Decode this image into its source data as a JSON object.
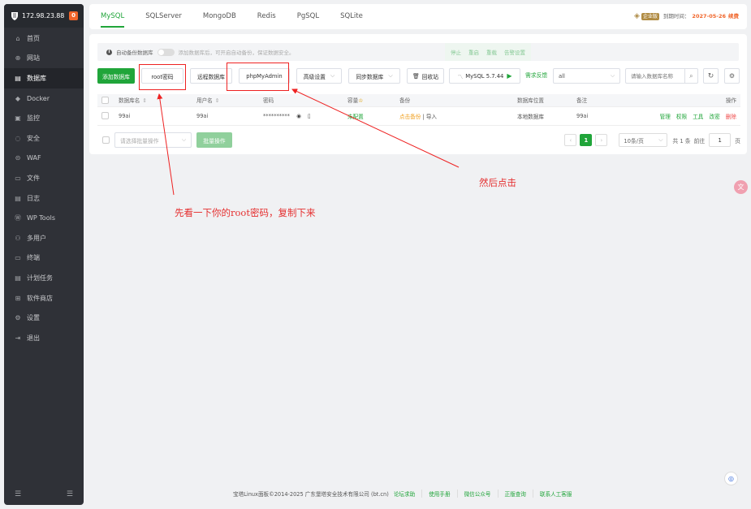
{
  "sidebar": {
    "ip": "172.98.23.88",
    "badge": "0",
    "items": [
      {
        "label": "首页",
        "icon": "home-icon",
        "glyph": "⌂"
      },
      {
        "label": "网站",
        "icon": "globe-icon",
        "glyph": "⊕"
      },
      {
        "label": "数据库",
        "icon": "database-icon",
        "glyph": "▤",
        "active": true
      },
      {
        "label": "Docker",
        "icon": "docker-icon",
        "glyph": "◆"
      },
      {
        "label": "监控",
        "icon": "monitor-icon",
        "glyph": "▣"
      },
      {
        "label": "安全",
        "icon": "shield-icon",
        "glyph": "◌"
      },
      {
        "label": "WAF",
        "icon": "waf-icon",
        "glyph": "⊝"
      },
      {
        "label": "文件",
        "icon": "folder-icon",
        "glyph": "▭"
      },
      {
        "label": "日志",
        "icon": "log-icon",
        "glyph": "▤"
      },
      {
        "label": "WP Tools",
        "icon": "wordpress-icon",
        "glyph": "Ⓦ"
      },
      {
        "label": "多用户",
        "icon": "users-icon",
        "glyph": "⚇"
      },
      {
        "label": "终端",
        "icon": "terminal-icon",
        "glyph": "▭"
      },
      {
        "label": "计划任务",
        "icon": "schedule-icon",
        "glyph": "▤"
      },
      {
        "label": "软件商店",
        "icon": "store-icon",
        "glyph": "⊞"
      },
      {
        "label": "设置",
        "icon": "gear-icon",
        "glyph": "⚙"
      },
      {
        "label": "退出",
        "icon": "logout-icon",
        "glyph": "⇥"
      }
    ],
    "footer_left": "☰",
    "footer_right": "☰"
  },
  "topbar": {
    "tabs": [
      "MySQL",
      "SQLServer",
      "MongoDB",
      "Redis",
      "PgSQL",
      "SQLite"
    ],
    "active_tab": "MySQL",
    "edition": "企业版",
    "expire_label": "到期时间：",
    "expire_date": "2027-05-26",
    "renew": "续费"
  },
  "notice": {
    "label": "自动备份数据库",
    "hint": "添加数据库后，可开启自动备份，保证数据安全。",
    "actions": [
      "停止",
      "重启",
      "重载",
      "告警设置"
    ]
  },
  "toolbar": {
    "add_db": "添加数据库",
    "root_pwd": "root密码",
    "remote_db": "远程数据库",
    "phpmyadmin": "phpMyAdmin",
    "advanced": "高级设置",
    "sync": "同步数据库",
    "recycle": "回收站",
    "mysql_version": "MySQL 5.7.44",
    "feedback": "需求反馈",
    "filter_value": "all",
    "search_placeholder": "请输入数据库名称"
  },
  "table": {
    "headers": {
      "name": "数据库名",
      "user": "用户名",
      "password": "密码",
      "capacity": "容量",
      "backup": "备份",
      "location": "数据库位置",
      "remark": "备注",
      "action": "操作"
    },
    "rows": [
      {
        "name": "99ai",
        "user": "99ai",
        "password": "**********",
        "capacity": "未配置",
        "backup_link": "点击备份",
        "backup_sep": "|",
        "import": "导入",
        "location": "本地数据库",
        "remark": "99ai",
        "actions": [
          "管理",
          "权限",
          "工具",
          "改密",
          "删除"
        ]
      }
    ]
  },
  "batch": {
    "placeholder": "请选择批量操作",
    "button": "批量操作"
  },
  "pager": {
    "current": "1",
    "per_page": "10条/页",
    "total": "共 1 条",
    "goto": "前往",
    "goto_value": "1",
    "page_unit": "页"
  },
  "annotations": {
    "note1": "先看一下你的root密码，复制下来",
    "note2": "然后点击"
  },
  "footer": {
    "copyright": "宝塔Linux面板©2014-2025 广东堡塔安全技术有限公司 (bt.cn)",
    "links": [
      "论坛求助",
      "使用手册",
      "微信公众号",
      "正版查询",
      "联系人工客服"
    ]
  },
  "colors": {
    "accent": "#20a53a",
    "annotation": "#e22222",
    "sidebar": "#2f3137"
  }
}
